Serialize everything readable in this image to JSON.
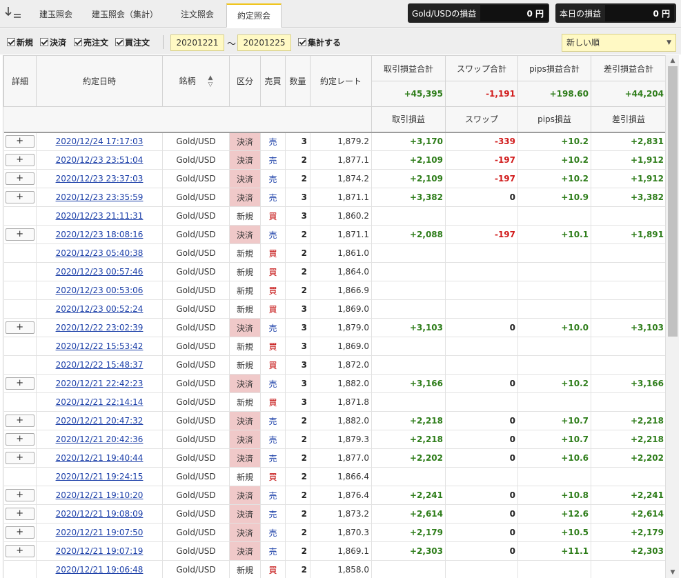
{
  "tabs": [
    {
      "label": "建玉照会"
    },
    {
      "label": "建玉照会（集計）"
    },
    {
      "label": "注文照会"
    },
    {
      "label": "約定照会"
    }
  ],
  "pl": {
    "gold_label": "Gold/USDの損益",
    "gold_value": "0 円",
    "today_label": "本日の損益",
    "today_value": "0 円"
  },
  "filters": {
    "new": "新規",
    "settle": "決済",
    "sell": "売注文",
    "buy": "買注文",
    "date_from": "20201221",
    "tilde": "～",
    "date_to": "20201225",
    "aggregate": "集計する",
    "sort_selected": "新しい順"
  },
  "headers": {
    "detail": "詳細",
    "date": "約定日時",
    "symbol": "銘柄",
    "kbn": "区分",
    "side": "売買",
    "qty": "数量",
    "rate": "約定レート",
    "trade_pl_total": "取引損益合計",
    "swap_total": "スワップ合計",
    "pips_total": "pips損益合計",
    "net_total": "差引損益合計",
    "trade_pl": "取引損益",
    "swap": "スワップ",
    "pips": "pips損益",
    "net": "差引損益"
  },
  "totals": {
    "trade_pl": "+45,395",
    "swap": "-1,191",
    "pips": "+198.60",
    "net": "+44,204"
  },
  "rows": [
    {
      "detail": "+",
      "date": "2020/12/24 17:17:03",
      "symbol": "Gold/USD",
      "kbn": "決済",
      "side": "売",
      "qty": "3",
      "rate": "1,879.2",
      "trade_pl": "+3,170",
      "swap": "-339",
      "pips": "+10.2",
      "net": "+2,831"
    },
    {
      "detail": "+",
      "date": "2020/12/23 23:51:04",
      "symbol": "Gold/USD",
      "kbn": "決済",
      "side": "売",
      "qty": "2",
      "rate": "1,877.1",
      "trade_pl": "+2,109",
      "swap": "-197",
      "pips": "+10.2",
      "net": "+1,912"
    },
    {
      "detail": "+",
      "date": "2020/12/23 23:37:03",
      "symbol": "Gold/USD",
      "kbn": "決済",
      "side": "売",
      "qty": "2",
      "rate": "1,874.2",
      "trade_pl": "+2,109",
      "swap": "-197",
      "pips": "+10.2",
      "net": "+1,912"
    },
    {
      "detail": "+",
      "date": "2020/12/23 23:35:59",
      "symbol": "Gold/USD",
      "kbn": "決済",
      "side": "売",
      "qty": "3",
      "rate": "1,871.1",
      "trade_pl": "+3,382",
      "swap": "0",
      "pips": "+10.9",
      "net": "+3,382"
    },
    {
      "detail": "",
      "date": "2020/12/23 21:11:31",
      "symbol": "Gold/USD",
      "kbn": "新規",
      "side": "買",
      "qty": "3",
      "rate": "1,860.2",
      "trade_pl": "",
      "swap": "",
      "pips": "",
      "net": ""
    },
    {
      "detail": "+",
      "date": "2020/12/23 18:08:16",
      "symbol": "Gold/USD",
      "kbn": "決済",
      "side": "売",
      "qty": "2",
      "rate": "1,871.1",
      "trade_pl": "+2,088",
      "swap": "-197",
      "pips": "+10.1",
      "net": "+1,891"
    },
    {
      "detail": "",
      "date": "2020/12/23 05:40:38",
      "symbol": "Gold/USD",
      "kbn": "新規",
      "side": "買",
      "qty": "2",
      "rate": "1,861.0",
      "trade_pl": "",
      "swap": "",
      "pips": "",
      "net": ""
    },
    {
      "detail": "",
      "date": "2020/12/23 00:57:46",
      "symbol": "Gold/USD",
      "kbn": "新規",
      "side": "買",
      "qty": "2",
      "rate": "1,864.0",
      "trade_pl": "",
      "swap": "",
      "pips": "",
      "net": ""
    },
    {
      "detail": "",
      "date": "2020/12/23 00:53:06",
      "symbol": "Gold/USD",
      "kbn": "新規",
      "side": "買",
      "qty": "2",
      "rate": "1,866.9",
      "trade_pl": "",
      "swap": "",
      "pips": "",
      "net": ""
    },
    {
      "detail": "",
      "date": "2020/12/23 00:52:24",
      "symbol": "Gold/USD",
      "kbn": "新規",
      "side": "買",
      "qty": "3",
      "rate": "1,869.0",
      "trade_pl": "",
      "swap": "",
      "pips": "",
      "net": ""
    },
    {
      "detail": "+",
      "date": "2020/12/22 23:02:39",
      "symbol": "Gold/USD",
      "kbn": "決済",
      "side": "売",
      "qty": "3",
      "rate": "1,879.0",
      "trade_pl": "+3,103",
      "swap": "0",
      "pips": "+10.0",
      "net": "+3,103"
    },
    {
      "detail": "",
      "date": "2020/12/22 15:53:42",
      "symbol": "Gold/USD",
      "kbn": "新規",
      "side": "買",
      "qty": "3",
      "rate": "1,869.0",
      "trade_pl": "",
      "swap": "",
      "pips": "",
      "net": ""
    },
    {
      "detail": "",
      "date": "2020/12/22 15:48:37",
      "symbol": "Gold/USD",
      "kbn": "新規",
      "side": "買",
      "qty": "3",
      "rate": "1,872.0",
      "trade_pl": "",
      "swap": "",
      "pips": "",
      "net": ""
    },
    {
      "detail": "+",
      "date": "2020/12/21 22:42:23",
      "symbol": "Gold/USD",
      "kbn": "決済",
      "side": "売",
      "qty": "3",
      "rate": "1,882.0",
      "trade_pl": "+3,166",
      "swap": "0",
      "pips": "+10.2",
      "net": "+3,166"
    },
    {
      "detail": "",
      "date": "2020/12/21 22:14:14",
      "symbol": "Gold/USD",
      "kbn": "新規",
      "side": "買",
      "qty": "3",
      "rate": "1,871.8",
      "trade_pl": "",
      "swap": "",
      "pips": "",
      "net": ""
    },
    {
      "detail": "+",
      "date": "2020/12/21 20:47:32",
      "symbol": "Gold/USD",
      "kbn": "決済",
      "side": "売",
      "qty": "2",
      "rate": "1,882.0",
      "trade_pl": "+2,218",
      "swap": "0",
      "pips": "+10.7",
      "net": "+2,218"
    },
    {
      "detail": "+",
      "date": "2020/12/21 20:42:36",
      "symbol": "Gold/USD",
      "kbn": "決済",
      "side": "売",
      "qty": "2",
      "rate": "1,879.3",
      "trade_pl": "+2,218",
      "swap": "0",
      "pips": "+10.7",
      "net": "+2,218"
    },
    {
      "detail": "+",
      "date": "2020/12/21 19:40:44",
      "symbol": "Gold/USD",
      "kbn": "決済",
      "side": "売",
      "qty": "2",
      "rate": "1,877.0",
      "trade_pl": "+2,202",
      "swap": "0",
      "pips": "+10.6",
      "net": "+2,202"
    },
    {
      "detail": "",
      "date": "2020/12/21 19:24:15",
      "symbol": "Gold/USD",
      "kbn": "新規",
      "side": "買",
      "qty": "2",
      "rate": "1,866.4",
      "trade_pl": "",
      "swap": "",
      "pips": "",
      "net": ""
    },
    {
      "detail": "+",
      "date": "2020/12/21 19:10:20",
      "symbol": "Gold/USD",
      "kbn": "決済",
      "side": "売",
      "qty": "2",
      "rate": "1,876.4",
      "trade_pl": "+2,241",
      "swap": "0",
      "pips": "+10.8",
      "net": "+2,241"
    },
    {
      "detail": "+",
      "date": "2020/12/21 19:08:09",
      "symbol": "Gold/USD",
      "kbn": "決済",
      "side": "売",
      "qty": "2",
      "rate": "1,873.2",
      "trade_pl": "+2,614",
      "swap": "0",
      "pips": "+12.6",
      "net": "+2,614"
    },
    {
      "detail": "+",
      "date": "2020/12/21 19:07:50",
      "symbol": "Gold/USD",
      "kbn": "決済",
      "side": "売",
      "qty": "2",
      "rate": "1,870.3",
      "trade_pl": "+2,179",
      "swap": "0",
      "pips": "+10.5",
      "net": "+2,179"
    },
    {
      "detail": "+",
      "date": "2020/12/21 19:07:19",
      "symbol": "Gold/USD",
      "kbn": "決済",
      "side": "売",
      "qty": "2",
      "rate": "1,869.1",
      "trade_pl": "+2,303",
      "swap": "0",
      "pips": "+11.1",
      "net": "+2,303"
    },
    {
      "detail": "",
      "date": "2020/12/21 19:06:48",
      "symbol": "Gold/USD",
      "kbn": "新規",
      "side": "買",
      "qty": "2",
      "rate": "1,858.0",
      "trade_pl": "",
      "swap": "",
      "pips": "",
      "net": ""
    }
  ],
  "colors": {
    "positive": "#2e7d1a",
    "negative": "#d11a1a",
    "settle_bg": "#f0c9c9",
    "sell": "#1a3ea8",
    "buy": "#c00000",
    "active_tab_accent": "#f0c419",
    "date_input_bg": "#fff9c4"
  },
  "icons": {
    "sort_toggle": "sort-down-icon",
    "dropdown": "chevron-down-icon"
  }
}
